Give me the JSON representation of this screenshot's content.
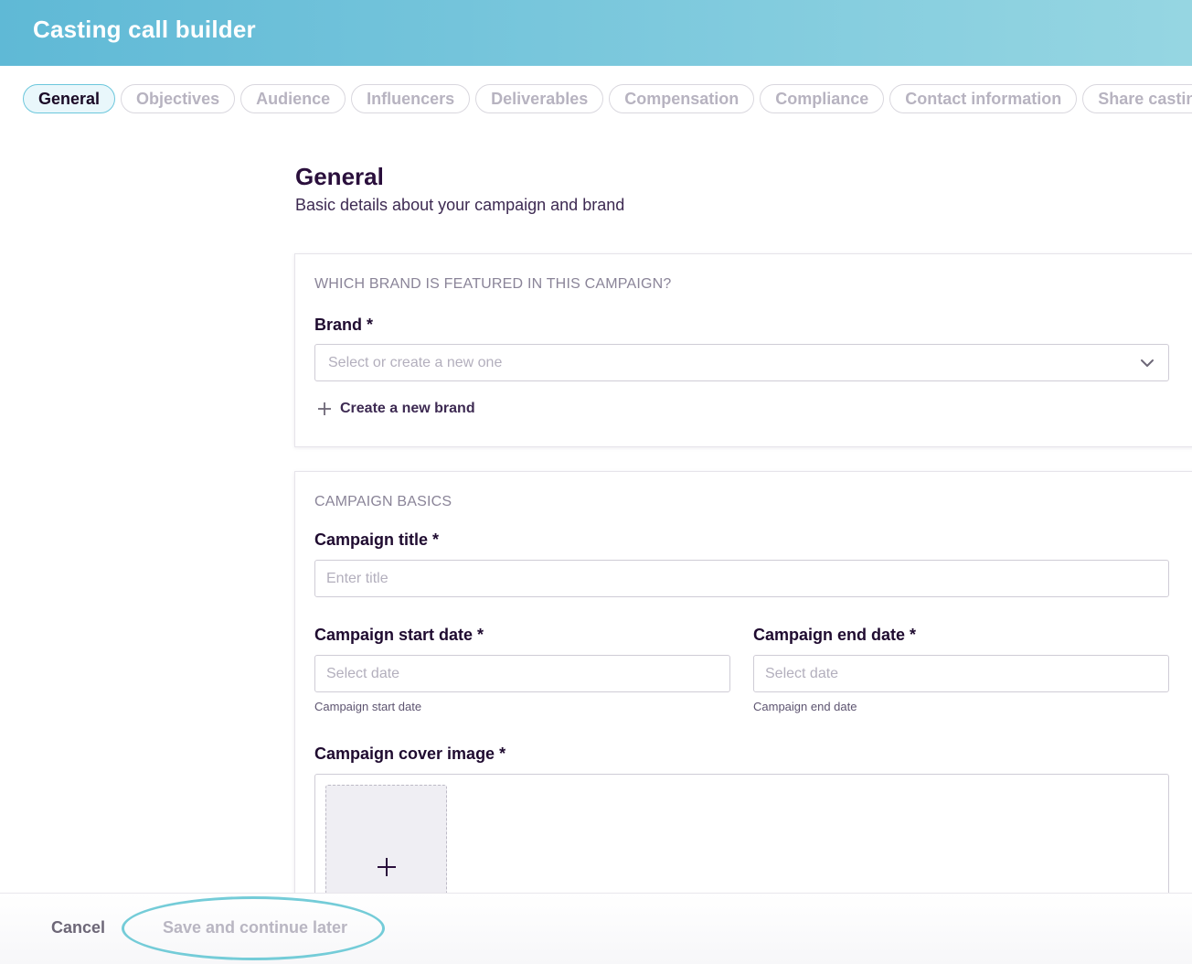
{
  "header": {
    "title": "Casting call builder"
  },
  "tabs": [
    {
      "label": "General",
      "active": true
    },
    {
      "label": "Objectives"
    },
    {
      "label": "Audience"
    },
    {
      "label": "Influencers"
    },
    {
      "label": "Deliverables"
    },
    {
      "label": "Compensation"
    },
    {
      "label": "Compliance"
    },
    {
      "label": "Contact information"
    },
    {
      "label": "Share casting call"
    }
  ],
  "section": {
    "title": "General",
    "subtitle": "Basic details about your campaign and brand"
  },
  "brand_card": {
    "heading": "WHICH BRAND IS FEATURED IN THIS CAMPAIGN?",
    "brand_label": "Brand *",
    "brand_placeholder": "Select or create a new one",
    "create_brand_label": "Create a new brand"
  },
  "basics_card": {
    "heading": "CAMPAIGN BASICS",
    "title_label": "Campaign title *",
    "title_placeholder": "Enter title",
    "start_label": "Campaign start date *",
    "start_placeholder": "Select date",
    "start_helper": "Campaign start date",
    "end_label": "Campaign end date *",
    "end_placeholder": "Select date",
    "end_helper": "Campaign end date",
    "cover_label": "Campaign cover image *"
  },
  "footer": {
    "cancel_label": "Cancel",
    "save_later_label": "Save and continue later"
  },
  "colors": {
    "header_gradient_start": "#5fb9d6",
    "header_gradient_end": "#96d6e2",
    "active_tab_border": "#6cc7dc",
    "highlight_ring": "#74ccd8",
    "primary_text": "#2a0f3c"
  },
  "icons": {
    "brand_dropdown": "chevron-down-icon",
    "create_brand": "plus-icon",
    "upload": "plus-icon"
  }
}
